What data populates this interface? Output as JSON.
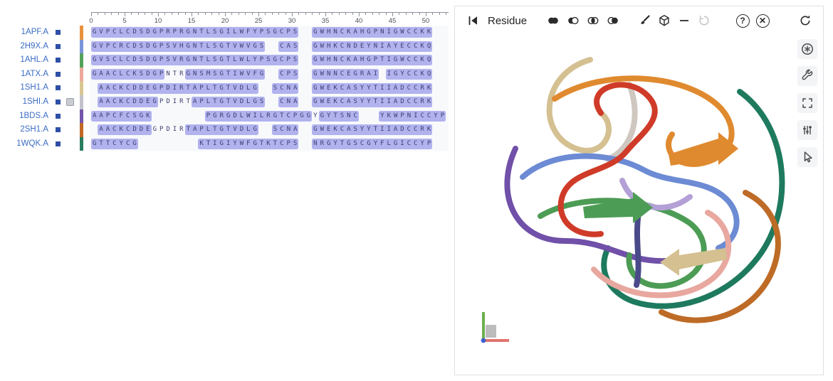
{
  "colors": {
    "highlight": "#b1b2ee",
    "sequence_text": "#3c3f6e",
    "label_blue": "#3b6cc5",
    "square_blue": "#2e4fa5"
  },
  "alignment": {
    "ruler": {
      "max_col": 53,
      "label_step": 5,
      "labels": [
        "0",
        "5",
        "10",
        "15",
        "20",
        "25",
        "30",
        "35",
        "40",
        "45",
        "50"
      ]
    },
    "rows": [
      {
        "label": "1APF.A",
        "chain_color": "#E8923F",
        "pinned": false,
        "segments": [
          {
            "t": "GVPCLCDSDGPRPRGNTLSGILWFYPSGCPS",
            "h": true
          },
          {
            "t": "  ",
            "h": false
          },
          {
            "t": "GWHNCKAHGPNIGWCCKK",
            "h": true
          }
        ]
      },
      {
        "label": "2H9X.A",
        "chain_color": "#7A94D8",
        "pinned": false,
        "segments": [
          {
            "t": "GVPCRCDSDGPSVHGNTLSGTVWVGS",
            "h": true
          },
          {
            "t": "  ",
            "h": false
          },
          {
            "t": "CAS",
            "h": true
          },
          {
            "t": "  ",
            "h": false
          },
          {
            "t": "GWHKCNDEYNIAYECCKQ",
            "h": true
          }
        ]
      },
      {
        "label": "1AHL.A",
        "chain_color": "#55A25C",
        "pinned": false,
        "segments": [
          {
            "t": "GVSCLCDSDGPSVRGNTLSGTLWLYPSGCPS",
            "h": true
          },
          {
            "t": "  ",
            "h": false
          },
          {
            "t": "GWHNCKAHGPTIGWCCKQ",
            "h": true
          }
        ]
      },
      {
        "label": "1ATX.A",
        "chain_color": "#EDA89D",
        "pinned": false,
        "segments": [
          {
            "t": "GAACLCKSDGP",
            "h": true
          },
          {
            "t": "NTR",
            "h": false
          },
          {
            "t": "GNSMSGTIWVFG",
            "h": true
          },
          {
            "t": "  ",
            "h": false
          },
          {
            "t": "CPS",
            "h": true
          },
          {
            "t": "  ",
            "h": false
          },
          {
            "t": "GWNNCEGRAI",
            "h": true
          },
          {
            "t": " ",
            "h": false
          },
          {
            "t": "IGYCCKQ",
            "h": true
          }
        ]
      },
      {
        "label": "1SH1.A",
        "chain_color": "#D9C693",
        "pinned": false,
        "segments": [
          {
            "t": " ",
            "h": false
          },
          {
            "t": "AACKCDDEGPDIRTAPLTGTVDLG",
            "h": true
          },
          {
            "t": "  ",
            "h": false
          },
          {
            "t": "SCNA",
            "h": true
          },
          {
            "t": "  ",
            "h": false
          },
          {
            "t": "GWEKCASYYTIIADCCRK",
            "h": true
          }
        ]
      },
      {
        "label": "1SHI.A",
        "chain_color": "#C2C2CC",
        "pinned": true,
        "segments": [
          {
            "t": " ",
            "h": false
          },
          {
            "t": "AACKCDDEG",
            "h": true
          },
          {
            "t": "PDIRT",
            "h": false
          },
          {
            "t": "APLTGTVDLGS",
            "h": true
          },
          {
            "t": "  ",
            "h": false
          },
          {
            "t": "CNA",
            "h": true
          },
          {
            "t": "  ",
            "h": false
          },
          {
            "t": "GWEKCASYYTIIADCCRK",
            "h": true
          }
        ]
      },
      {
        "label": "1BDS.A",
        "chain_color": "#7656AA",
        "pinned": false,
        "segments": [
          {
            "t": "AAPCFCSGK",
            "h": true
          },
          {
            "t": "        ",
            "h": false
          },
          {
            "t": "PGRGDLWILRGTCPGG",
            "h": true
          },
          {
            "t": "Y",
            "h": false
          },
          {
            "t": "GYTSNC",
            "h": true
          },
          {
            "t": "   ",
            "h": false
          },
          {
            "t": "YKWPNICCYP",
            "h": true
          }
        ]
      },
      {
        "label": "2SH1.A",
        "chain_color": "#C16A27",
        "pinned": false,
        "segments": [
          {
            "t": " ",
            "h": false
          },
          {
            "t": "AACKCDDE",
            "h": true
          },
          {
            "t": "GPDIR",
            "h": false
          },
          {
            "t": "TAPLTGTVDLG",
            "h": true
          },
          {
            "t": "  ",
            "h": false
          },
          {
            "t": "SCNA",
            "h": true
          },
          {
            "t": "  ",
            "h": false
          },
          {
            "t": "GWEKCASYYTIIADCCRK",
            "h": true
          }
        ]
      },
      {
        "label": "1WQK.A",
        "chain_color": "#297D5E",
        "pinned": false,
        "segments": [
          {
            "t": "GTTCYCG",
            "h": true
          },
          {
            "t": "         ",
            "h": false
          },
          {
            "t": "KTIGIYWFGTKTCPS",
            "h": true
          },
          {
            "t": "  ",
            "h": false
          },
          {
            "t": "NRGYTGSCGYFLGICCYP",
            "h": true
          }
        ]
      }
    ]
  },
  "viewer": {
    "toolbar": {
      "granularity": "Residue",
      "help_glyph": "?",
      "close_glyph": "✕"
    },
    "icons": {
      "skip_to_start": "|◀",
      "selection_union": "two-filled-circles",
      "selection_subtract": "filled-plus-outline-circle",
      "selection_intersect": "overlap-filled-circles",
      "selection_set": "outline-plus-filled-circle",
      "apply-theme": "brush",
      "representation": "cube",
      "deselect": "−",
      "history": "undo-arrow",
      "refresh": "circular-arrow",
      "reset_camera": "circled-asterisk",
      "advanced_controls": "wrench",
      "expand_viewport": "corner-brackets",
      "viewport_settings": "sliders",
      "selection_mode": "cursor-arrow"
    }
  }
}
